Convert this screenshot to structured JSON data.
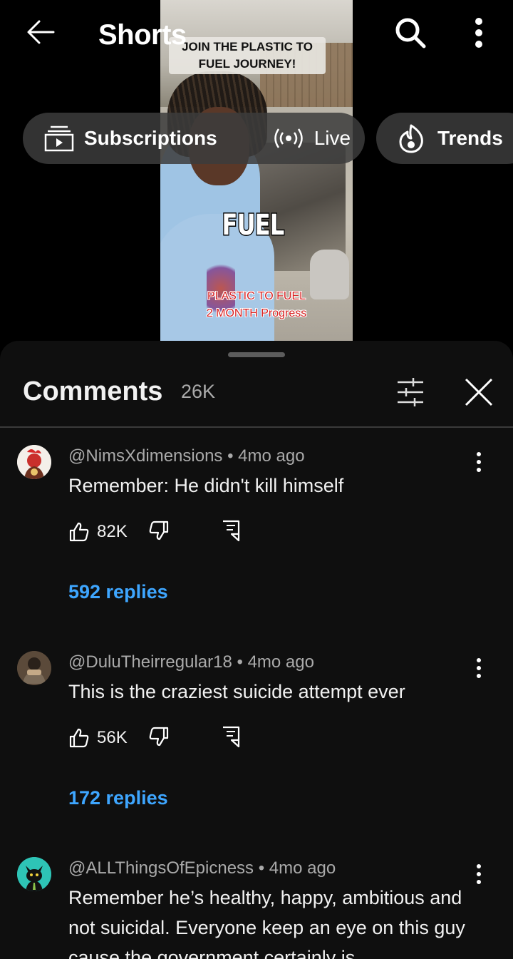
{
  "topbar": {
    "title": "Shorts",
    "back_icon": "arrow-left-icon",
    "search_icon": "search-icon",
    "more_icon": "more-vert-icon"
  },
  "video": {
    "caption_top": "JOIN THE PLASTIC TO FUEL JOURNEY!",
    "caption_mid": "FUEL",
    "caption_bottom_1": "PLASTIC TO FUEL",
    "caption_bottom_2": "2 MONTH Progress"
  },
  "chips": {
    "subscriptions": "Subscriptions",
    "live": "Live",
    "trends": "Trends"
  },
  "comments_panel": {
    "title": "Comments",
    "count": "26K",
    "filter_icon": "tune-icon",
    "close_icon": "close-icon"
  },
  "comments": [
    {
      "author": "@NimsXdimensions",
      "age": "4mo ago",
      "text": "Remember: He didn't kill himself",
      "likes": "82K",
      "replies": "592 replies",
      "avatar_color": "#f4efe9"
    },
    {
      "author": "@DuluTheirregular18",
      "age": "4mo ago",
      "text": "This is the craziest suicide attempt ever",
      "likes": "56K",
      "replies": "172 replies",
      "avatar_color": "#5b4a3a"
    },
    {
      "author": "@ALLThingsOfEpicness",
      "age": "4mo ago",
      "text": "Remember he’s healthy, happy, ambitious and not suicidal. Everyone keep an eye on this guy cause the government certainly is",
      "avatar_color": "#2ec4b6"
    }
  ],
  "colors": {
    "sheet_bg": "#0f0f0f",
    "link_blue": "#3ea6ff",
    "meta_gray": "#aaaaaa"
  }
}
